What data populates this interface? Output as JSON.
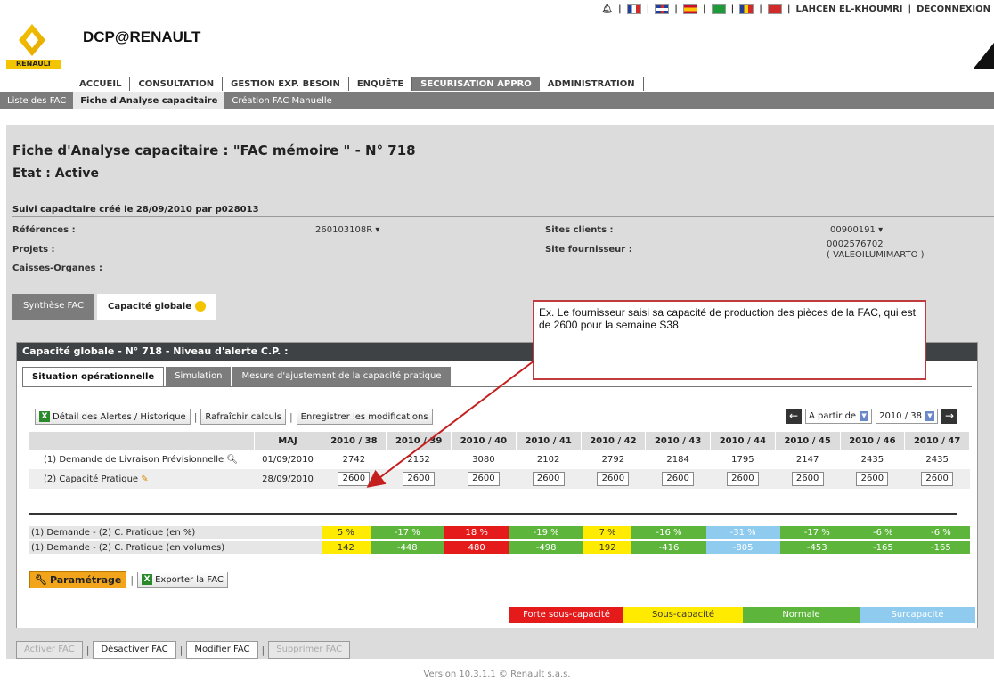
{
  "topbar": {
    "user": "LAHCEN EL-KHOUMRI",
    "logout": "DÉCONNEXION",
    "flags": [
      "fr",
      "uk",
      "es",
      "br",
      "ro",
      "tr"
    ]
  },
  "brand": {
    "logo_text": "RENAULT",
    "app_title": "DCP@RENAULT"
  },
  "mainnav": [
    "ACCUEIL",
    "CONSULTATION",
    "GESTION EXP. BESOIN",
    "ENQUÊTE",
    "SECURISATION APPRO",
    "ADMINISTRATION"
  ],
  "mainnav_active": "SECURISATION APPRO",
  "subnav": [
    "Liste des FAC",
    "Fiche d'Analyse capacitaire",
    "Création FAC Manuelle"
  ],
  "subnav_active": "Fiche d'Analyse capacitaire",
  "page": {
    "title": "Fiche d'Analyse capacitaire : \"FAC mémoire \" - N° 718",
    "etat": "Etat : Active",
    "suivi": "Suivi capacitaire créé le 28/09/2010 par p028013"
  },
  "info": {
    "references_label": "Références :",
    "references_value": "260103108R ▾",
    "projets_label": "Projets :",
    "caisses_label": "Caisses-Organes :",
    "sites_clients_label": "Sites clients :",
    "sites_clients_value": "00900191 ▾",
    "site_fournisseur_label": "Site fournisseur :",
    "site_fournisseur_code": "0002576702",
    "site_fournisseur_name": "( VALEOILUMIMARTO )"
  },
  "tabs1": [
    "Synthèse FAC",
    "Capacité globale"
  ],
  "panel": {
    "title": "Capacité globale - N° 718 - Niveau d'alerte C.P. :",
    "tabs": [
      "Situation opérationnelle",
      "Simulation",
      "Mesure d'ajustement de la capacité pratique"
    ],
    "toolbar": {
      "detail": "Détail des Alertes / Historique",
      "refresh": "Rafraîchir calculs",
      "save": "Enregistrer les modifications",
      "from_label": "A partir de",
      "week_value": "2010 / 38"
    },
    "grid": {
      "maj_header": "MAJ",
      "weeks": [
        "2010 / 38",
        "2010 / 39",
        "2010 / 40",
        "2010 / 41",
        "2010 / 42",
        "2010 / 43",
        "2010 / 44",
        "2010 / 45",
        "2010 / 46",
        "2010 / 47"
      ],
      "demand_label": "(1) Demande de Livraison Prévisionnelle",
      "demand_maj": "01/09/2010",
      "demand_values": [
        "2742",
        "2152",
        "3080",
        "2102",
        "2792",
        "2184",
        "1795",
        "2147",
        "2435",
        "2435"
      ],
      "capacity_label": "(2) Capacité Pratique",
      "capacity_maj": "28/09/2010",
      "capacity_values": [
        "2600",
        "2600",
        "2600",
        "2600",
        "2600",
        "2600",
        "2600",
        "2600",
        "2600",
        "2600"
      ]
    },
    "analysis": {
      "pct_label": "(1) Demande - (2) C. Pratique (en %)",
      "pct_values": [
        "5 %",
        "-17 %",
        "18 %",
        "-19 %",
        "7 %",
        "-16 %",
        "-31 %",
        "-17 %",
        "-6 %",
        "-6 %"
      ],
      "vol_label": "(1) Demande - (2) C. Pratique (en volumes)",
      "vol_values": [
        "142",
        "-448",
        "480",
        "-498",
        "192",
        "-416",
        "-805",
        "-453",
        "-165",
        "-165"
      ],
      "status": [
        "yellow",
        "green",
        "red",
        "green",
        "yellow",
        "green",
        "blue",
        "green",
        "green",
        "green"
      ]
    },
    "buttons": {
      "param": "Paramétrage",
      "export": "Exporter la FAC"
    },
    "legend": [
      "Forte sous-capacité",
      "Sous-capacité",
      "Normale",
      "Surcapacité"
    ]
  },
  "bottom_buttons": [
    "Activer FAC",
    "Désactiver FAC",
    "Modifier FAC",
    "Supprimer FAC"
  ],
  "version": "Version 10.3.1.1 © Renault s.a.s.",
  "callout": "Ex. Le fournisseur saisi sa capacité de production des pièces de la FAC, qui est de 2600 pour la semaine S38",
  "colors": {
    "yellow": "#ffeb00",
    "green": "#5db53b",
    "red": "#e51b1b",
    "blue": "#8ecbee",
    "nav_grey": "#7c7c7c",
    "panel_head": "#3f4244"
  }
}
